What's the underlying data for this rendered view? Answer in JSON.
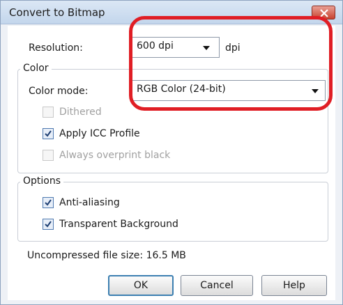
{
  "window": {
    "title": "Convert to Bitmap"
  },
  "resolution": {
    "label": "Resolution:",
    "value": "600 dpi",
    "unit": "dpi"
  },
  "color_group": {
    "legend": "Color",
    "color_mode_label": "Color mode:",
    "color_mode_value": "RGB Color (24-bit)",
    "dithered": {
      "label": "Dithered",
      "checked": false,
      "enabled": false
    },
    "apply_icc": {
      "label": "Apply ICC Profile",
      "checked": true,
      "enabled": true
    },
    "overprint": {
      "label": "Always overprint black",
      "checked": false,
      "enabled": false
    }
  },
  "options_group": {
    "legend": "Options",
    "anti_aliasing": {
      "label": "Anti-aliasing",
      "checked": true
    },
    "transparent_bg": {
      "label": "Transparent Background",
      "checked": true
    }
  },
  "file_size": "Uncompressed file size: 16.5 MB",
  "buttons": {
    "ok": "OK",
    "cancel": "Cancel",
    "help": "Help"
  },
  "colors": {
    "highlight": "#e01e25",
    "close_button": "#c8432f",
    "titlebar": "#c3d6ec"
  }
}
